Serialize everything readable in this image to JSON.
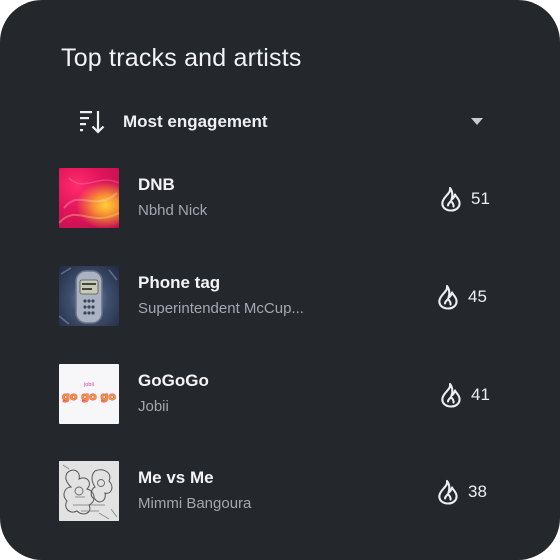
{
  "header": {
    "title": "Top tracks and artists"
  },
  "sort": {
    "label": "Most engagement",
    "icon": "sort-descending-icon"
  },
  "tracks": [
    {
      "title": "DNB",
      "artist": "Nbhd Nick",
      "count": "51"
    },
    {
      "title": "Phone tag",
      "artist": "Superintendent McCup...",
      "count": "45"
    },
    {
      "title": "GoGoGo",
      "artist": "Jobii",
      "count": "41",
      "cover_text_top": "jobii",
      "cover_text": "go go go"
    },
    {
      "title": "Me vs Me",
      "artist": "Mimmi Bangoura",
      "count": "38"
    }
  ],
  "colors": {
    "card_bg": "#24272c",
    "text_primary": "#f3f4f6",
    "text_secondary": "#a3a8af",
    "accent_orange": "#f39a21",
    "accent_pink": "#e2349b"
  }
}
